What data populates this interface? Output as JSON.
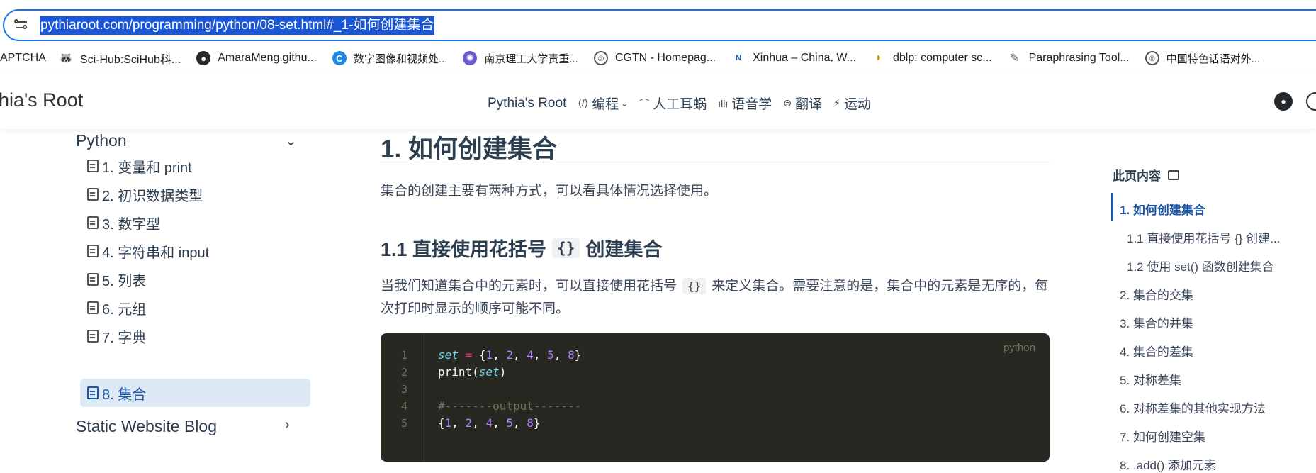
{
  "browser": {
    "url": "pythiaroot.com/programming/python/08-set.html#_1-如何创建集合",
    "bookmarks": [
      {
        "label": "APTCHA",
        "icon": "none"
      },
      {
        "label": "Sci-Hub:SciHub科...",
        "icon": "scihub-icon"
      },
      {
        "label": "AmaraMeng.githu...",
        "icon": "github-icon"
      },
      {
        "label": "数字图像和视频处...",
        "icon": "c-logo-icon"
      },
      {
        "label": "南京理工大学责重...",
        "icon": "university-icon"
      },
      {
        "label": "CGTN - Homepag...",
        "icon": "globe-icon"
      },
      {
        "label": "Xinhua – China, W...",
        "icon": "news-icon"
      },
      {
        "label": "dblp: computer sc...",
        "icon": "dblp-icon"
      },
      {
        "label": "Paraphrasing Tool...",
        "icon": "pen-icon"
      },
      {
        "label": "中国特色话语对外...",
        "icon": "globe-icon"
      }
    ]
  },
  "header": {
    "brand": "hia's Root",
    "nav": [
      {
        "label": "Pythia's Root",
        "icon": ""
      },
      {
        "label": "编程",
        "icon": "code-icon",
        "dropdown": true
      },
      {
        "label": "人工耳蜗",
        "icon": "ear-icon"
      },
      {
        "label": "语音学",
        "icon": "waveform-icon"
      },
      {
        "label": "翻译",
        "icon": "translate-icon"
      },
      {
        "label": "运动",
        "icon": "run-icon"
      }
    ]
  },
  "sidebar": {
    "group1": "Python",
    "items": [
      "1. 变量和 print",
      "2. 初识数据类型",
      "3. 数字型",
      "4. 字符串和 input",
      "5. 列表",
      "6. 元组",
      "7. 字典",
      "8. 集合"
    ],
    "active_index": 7,
    "group2": "Static Website Blog"
  },
  "main": {
    "h1": "1. 如何创建集合",
    "p1": "集合的创建主要有两种方式，可以看具体情况选择使用。",
    "h2_pre": "1.1 直接使用花括号",
    "h2_code": "{}",
    "h2_post": "创建集合",
    "p2_pre": "当我们知道集合中的元素时，可以直接使用花括号",
    "p2_code": "{}",
    "p2_post": "来定义集合。需要注意的是，集合中的元素是无序的，每次打印时显示的顺序可能不同。",
    "code": {
      "lang": "python",
      "line_numbers": [
        "1",
        "2",
        "3",
        "4",
        "5"
      ],
      "lines": [
        "set = {1, 2, 4, 5, 8}",
        "print(set)",
        "",
        "#-------output-------",
        "{1, 2, 4, 5, 8}"
      ]
    }
  },
  "toc": {
    "title": "此页内容",
    "items": [
      {
        "label": "1. 如何创建集合",
        "level": 1,
        "active": true
      },
      {
        "label": "1.1 直接使用花括号 {} 创建...",
        "level": 2
      },
      {
        "label": "1.2 使用 set() 函数创建集合",
        "level": 2
      },
      {
        "label": "2. 集合的交集",
        "level": 1
      },
      {
        "label": "3. 集合的并集",
        "level": 1
      },
      {
        "label": "4. 集合的差集",
        "level": 1
      },
      {
        "label": "5. 对称差集",
        "level": 1
      },
      {
        "label": "6. 对称差集的其他实现方法",
        "level": 1
      },
      {
        "label": "7. 如何创建空集",
        "level": 1
      },
      {
        "label": "8. .add() 添加元素",
        "level": 1
      }
    ]
  },
  "colors": {
    "accent": "#1a56a6",
    "active_bg": "#dde8f5",
    "code_bg": "#272822",
    "url_highlight": "#1a56d6"
  }
}
